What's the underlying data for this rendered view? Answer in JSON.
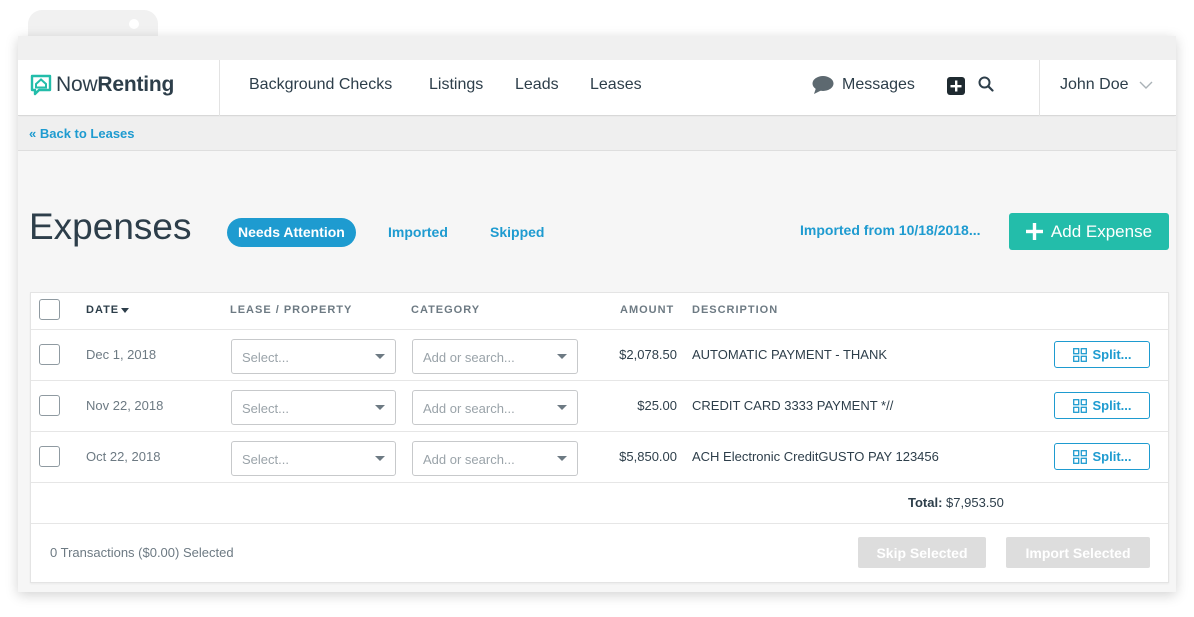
{
  "app": {
    "logo_text_light": "Now",
    "logo_text_bold": "Renting"
  },
  "nav": {
    "links": [
      "Background Checks",
      "Listings",
      "Leads",
      "Leases"
    ],
    "messages_label": "Messages",
    "user_name": "John Doe"
  },
  "subbar": {
    "back_label": "« Back to Leases"
  },
  "page": {
    "title": "Expenses",
    "tabs": [
      {
        "label": "Needs Attention",
        "active": true
      },
      {
        "label": "Imported",
        "active": false
      },
      {
        "label": "Skipped",
        "active": false
      }
    ],
    "imported_from": "Imported from 10/18/2018...",
    "add_button": "Add Expense"
  },
  "table": {
    "headers": {
      "date": "DATE",
      "lease": "LEASE / PROPERTY",
      "category": "CATEGORY",
      "amount": "AMOUNT",
      "description": "DESCRIPTION"
    },
    "rows": [
      {
        "date": "Dec 1, 2018",
        "lease_placeholder": "Select...",
        "category_placeholder": "Add or search...",
        "amount": "$2,078.50",
        "description": "AUTOMATIC PAYMENT - THANK",
        "split_label": "Split..."
      },
      {
        "date": "Nov 22, 2018",
        "lease_placeholder": "Select...",
        "category_placeholder": "Add or search...",
        "amount": "$25.00",
        "description": "CREDIT CARD 3333 PAYMENT *//",
        "split_label": "Split..."
      },
      {
        "date": "Oct 22, 2018",
        "lease_placeholder": "Select...",
        "category_placeholder": "Add or search...",
        "amount": "$5,850.00",
        "description": "ACH Electronic CreditGUSTO PAY 123456",
        "split_label": "Split..."
      }
    ],
    "total_label": "Total:",
    "total_value": "$7,953.50",
    "selected_summary": "0 Transactions ($0.00) Selected",
    "skip_button": "Skip Selected",
    "import_button": "Import Selected"
  },
  "colors": {
    "accent_blue": "#1e9bd0",
    "add_green": "#23bdaa",
    "text_dark": "#2d3e4a"
  }
}
